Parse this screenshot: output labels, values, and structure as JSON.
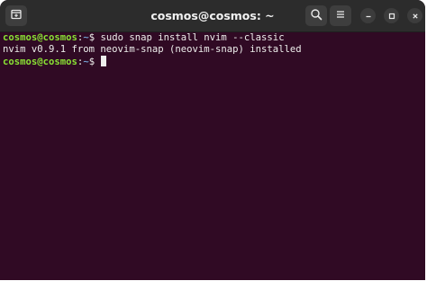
{
  "window": {
    "title": "cosmos@cosmos: ~"
  },
  "icons": {
    "new_tab": "new-tab-icon",
    "search": "search-icon",
    "menu": "hamburger-menu-icon",
    "minimize": "minimize-icon",
    "maximize": "maximize-icon",
    "close": "close-icon"
  },
  "colors": {
    "terminal_bg": "#300a24",
    "titlebar_bg": "#2c2c2c",
    "prompt_user": "#8ae234",
    "prompt_path": "#729fcf",
    "text": "#eeeeec"
  },
  "terminal": {
    "lines": [
      {
        "user": "cosmos@cosmos",
        "sep": ":",
        "path": "~",
        "symbol": "$",
        "command": " sudo snap install nvim --classic"
      },
      {
        "output": "nvim v0.9.1 from neovim-snap (neovim-snap) installed"
      },
      {
        "user": "cosmos@cosmos",
        "sep": ":",
        "path": "~",
        "symbol": "$",
        "command": " "
      }
    ]
  }
}
